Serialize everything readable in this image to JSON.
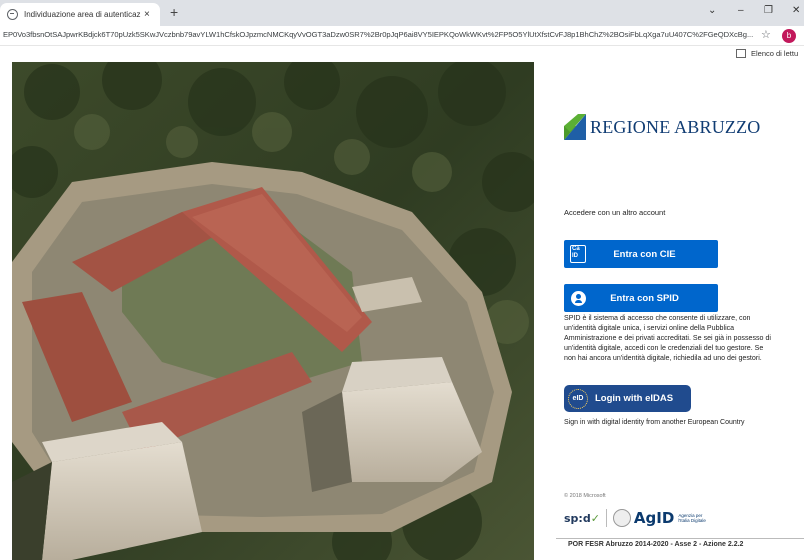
{
  "browser": {
    "tab_title": "Individuazione area di autenticaz",
    "tab_close": "×",
    "new_tab": "+",
    "window_controls": {
      "minimize": "⌄",
      "restore": "–",
      "maximize": "❐",
      "close": "✕"
    },
    "url": "EP0Vo3fbsnOtSAJpwrKBdjck6T70pUzk5SKwJVczbnb79avYLW1hCfskOJpzmcNMCKqyVvOGT3aDzw0SR7%2Br0pJqP6ai8VY5IEPKQoWkWKvt%2FP5O5YlUtXfstCvFJ8p1BhChZ%2BOsiFbLqXga7uU407C%2FGeQDXcBg...",
    "bookmark_star": "☆",
    "profile_initial": "b",
    "reading_list_label": "Elenco di lettu"
  },
  "login": {
    "org_name": "REGIONE ABRUZZO",
    "other_account_text": "Accedere con un altro account",
    "cie_icon_text": "Ca ID",
    "cie_button_label": "Entra con CIE",
    "spid_button_label": "Entra con SPID",
    "spid_description": "SPID è il sistema di accesso che consente di utilizzare, con un'identità digitale unica, i servizi online della Pubblica Amministrazione e dei privati accreditati. Se sei già in possesso di un'identità digitale, accedi con le credenziali del tuo gestore. Se non hai ancora un'identità digitale, richiedila ad uno dei gestori.",
    "eidas_icon_text": "eID",
    "eidas_button_label": "Login with eIDAS",
    "eidas_description": "Sign in with digital identity from another European Country",
    "copyright": "© 2018 Microsoft",
    "spid_logo_text": "sp:d",
    "spid_logo_check": "✓",
    "agid_text": "AgID",
    "agid_subtitle": "Agenzia per l'Italia Digitale",
    "footer": "POR FESR Abruzzo 2014-2020 - Asse 2 - Azione 2.2.2"
  },
  "colors": {
    "primary_button": "#0066cc",
    "eidas_button": "#204b8e",
    "brand_text": "#103c73",
    "logo_green": "#4c9a2a",
    "logo_blue": "#1f5fa6"
  },
  "icons": {
    "tab_favicon": "globe-icon",
    "cie": "cie-card-icon",
    "spid": "spid-user-icon",
    "eidas": "eu-stars-icon",
    "reading_list": "reading-list-icon"
  }
}
